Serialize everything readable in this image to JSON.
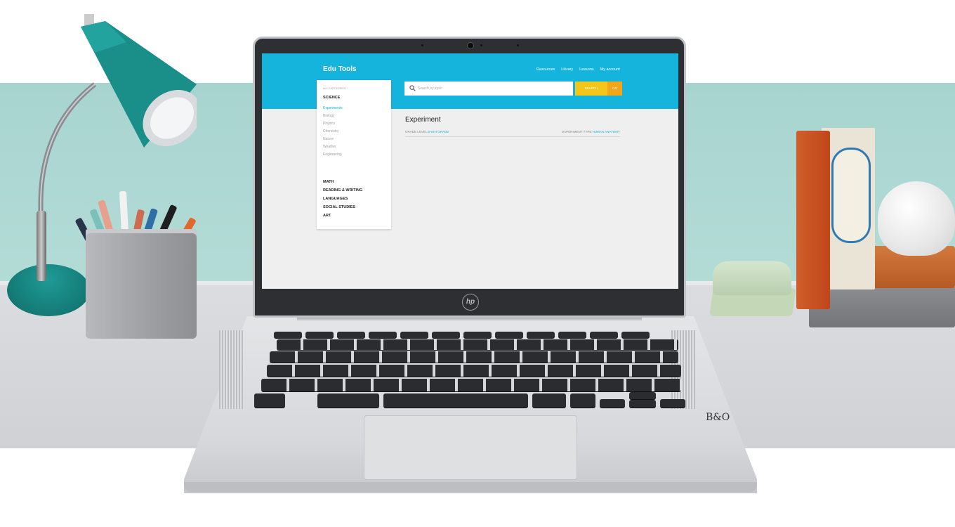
{
  "app": {
    "brand": "Edu Tools",
    "nav": [
      "Resources",
      "Library",
      "Lessons",
      "My account"
    ]
  },
  "sidebar": {
    "caption": "ALL CATEGORIES",
    "active_category": "SCIENCE",
    "subcategories": [
      "Experiments",
      "Biology",
      "Physics",
      "Chemistry",
      "Nature",
      "Weather",
      "Engineering"
    ],
    "active_subcategory": "Experiments",
    "categories": [
      "MATH",
      "READING & WRITING",
      "LANGUAGES",
      "SOCIAL STUDIES",
      "ART"
    ]
  },
  "search": {
    "placeholder": "Search by topic",
    "button_label": "SEARCH",
    "button2_label": "GO"
  },
  "main": {
    "title": "Experiment",
    "grade_label": "GRADE LEVEL:",
    "grade_value": "6-8TH GRADE",
    "type_label": "EXPERIMENT TYPE:",
    "type_value": "HUMAN ANATOMY"
  },
  "device": {
    "brand_logo": "hp",
    "audio_logo": "B&O"
  },
  "colors": {
    "header": "#15b4dc",
    "accent_yellow": "#f5c61a",
    "accent_orange": "#f4a61a"
  },
  "icons": [
    "search-icon"
  ]
}
